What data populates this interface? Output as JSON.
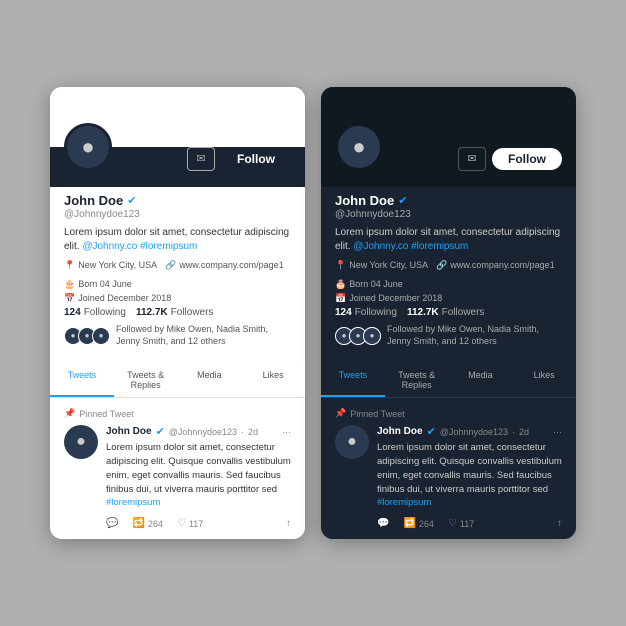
{
  "cards": [
    {
      "id": "light",
      "theme": "light",
      "follow_label": "Follow",
      "user": {
        "name": "John Doe",
        "handle": "@Johnnydoe123",
        "bio_text": "Lorem ipsum dolor sit amet, consectetur adipiscing elit.",
        "bio_link1": "@Johnny.co",
        "bio_link2": "#loremipsum",
        "location": "New York City, USA",
        "website": "www.company.com/page1",
        "born": "Born 04 June",
        "joined": "Joined December 2018",
        "following_count": "124",
        "following_label": "Following",
        "followers_count": "112.7K",
        "followers_label": "Followers",
        "followed_by": "Followed by Mike Owen, Nadia Smith, Jenny Smith, and 12 others"
      },
      "tabs": [
        "Tweets",
        "Tweets & Replies",
        "Media",
        "Likes"
      ],
      "active_tab": 0,
      "tweet": {
        "pinned": "Pinned Tweet",
        "name": "John Doe",
        "handle": "@Johnnydoe123",
        "time": "2d",
        "body": "Lorem ipsum dolor sit amet, consectetur adipiscing elit. Quisque convallis vestibulum enim, eget convallis mauris. Sed faucibus finibus dui, ut viverra mauris porttitor sed",
        "tag": "#loremipsum",
        "reply_count": "",
        "retweet_count": "264",
        "like_count": "117"
      }
    },
    {
      "id": "dark",
      "theme": "dark",
      "follow_label": "Follow",
      "user": {
        "name": "John Doe",
        "handle": "@Johnnydoe123",
        "bio_text": "Lorem ipsum dolor sit amet, consectetur adipiscing elit.",
        "bio_link1": "@Johnny.co",
        "bio_link2": "#loremipsum",
        "location": "New York City, USA",
        "website": "www.company.com/page1",
        "born": "Born 04 June",
        "joined": "Joined December 2018",
        "following_count": "124",
        "following_label": "Following",
        "followers_count": "112.7K",
        "followers_label": "Followers",
        "followed_by": "Followed by Mike Owen, Nadia Smith, Jenny Smith, and 12 others"
      },
      "tabs": [
        "Tweets",
        "Tweets & Replies",
        "Media",
        "Likes"
      ],
      "active_tab": 0,
      "tweet": {
        "pinned": "Pinned Tweet",
        "name": "John Doe",
        "handle": "@Johnnydoe123",
        "time": "2d",
        "body": "Lorem ipsum dolor sit amet, consectetur adipiscing elit. Quisque convallis vestibulum enim, eget convallis mauris. Sed faucibus finibus dui, ut viverra mauris porttitor sed",
        "tag": "#loremipsum",
        "reply_count": "",
        "retweet_count": "264",
        "like_count": "117"
      }
    }
  ]
}
